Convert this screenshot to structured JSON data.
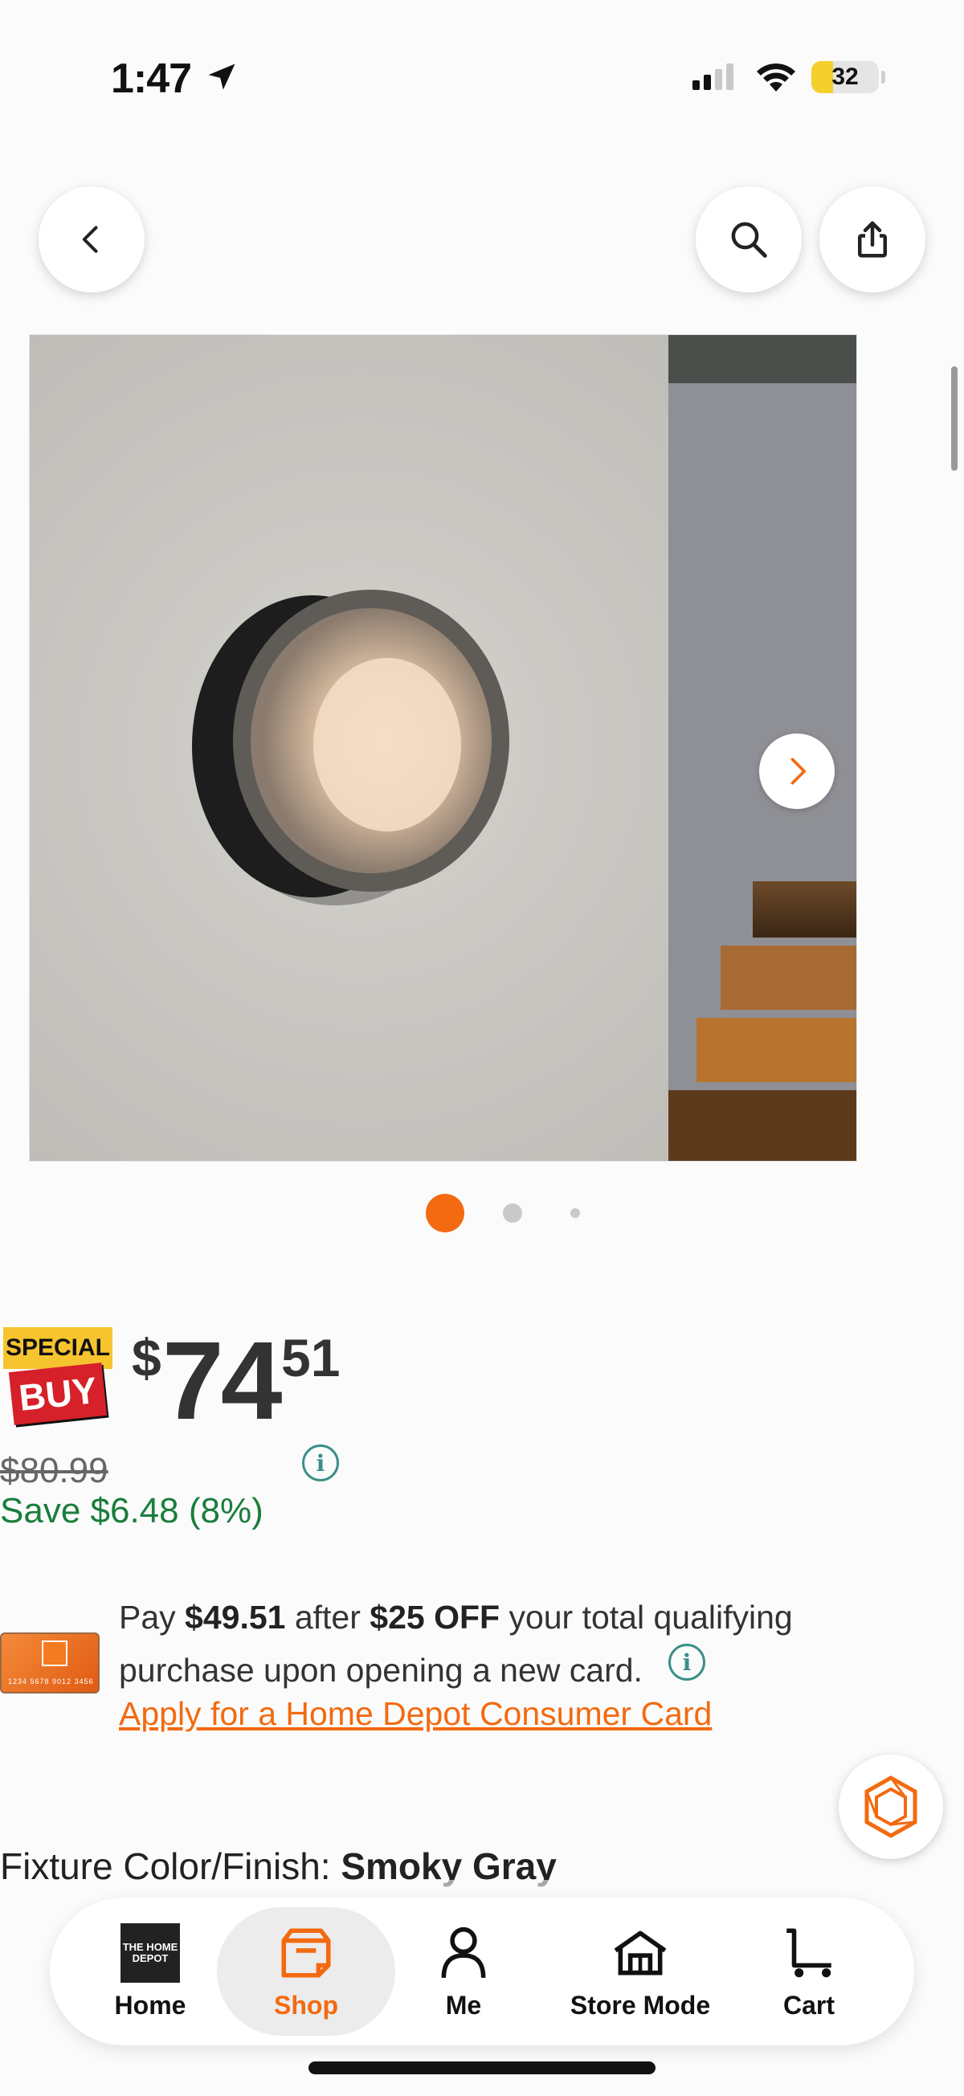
{
  "status_bar": {
    "time": "1:47",
    "battery": "32",
    "battery_level": 0.32
  },
  "header": {
    "back_icon": "chevron-left-icon",
    "search_icon": "search-icon",
    "share_icon": "share-icon"
  },
  "gallery": {
    "image_count": 3,
    "active_index": 0,
    "next_icon": "chevron-right-icon"
  },
  "badge": {
    "line1": "SPECIAL",
    "line2": "BUY"
  },
  "price": {
    "currency": "$",
    "dollars": "74",
    "cents": "51",
    "was": "$80.99",
    "save": "Save $6.48 (8%)"
  },
  "card_promo": {
    "card_number": "1234 5678 9012 3456",
    "text_pre": "Pay ",
    "amount": "$49.51",
    "text_mid": " after ",
    "discount": "$25 OFF",
    "text_post": " your total qualifying purchase upon opening a new card.",
    "link": "Apply for a Home Depot Consumer Card"
  },
  "fixture": {
    "label": "Fixture Color/Finish: ",
    "value": "Smoky Gray"
  },
  "nav": {
    "items": [
      {
        "label": "Home",
        "icon": "home-depot-logo-icon"
      },
      {
        "label": "Shop",
        "icon": "shop-icon",
        "active": true
      },
      {
        "label": "Me",
        "icon": "person-icon"
      },
      {
        "label": "Store Mode",
        "icon": "store-icon"
      },
      {
        "label": "Cart",
        "icon": "cart-icon"
      }
    ],
    "logo_text": "THE HOME DEPOT"
  },
  "colors": {
    "accent": "#F36A10",
    "save_green": "#1A7D3C",
    "info_teal": "#3A8F86",
    "badge_red": "#D6202A",
    "badge_yellow": "#F6C42E"
  }
}
